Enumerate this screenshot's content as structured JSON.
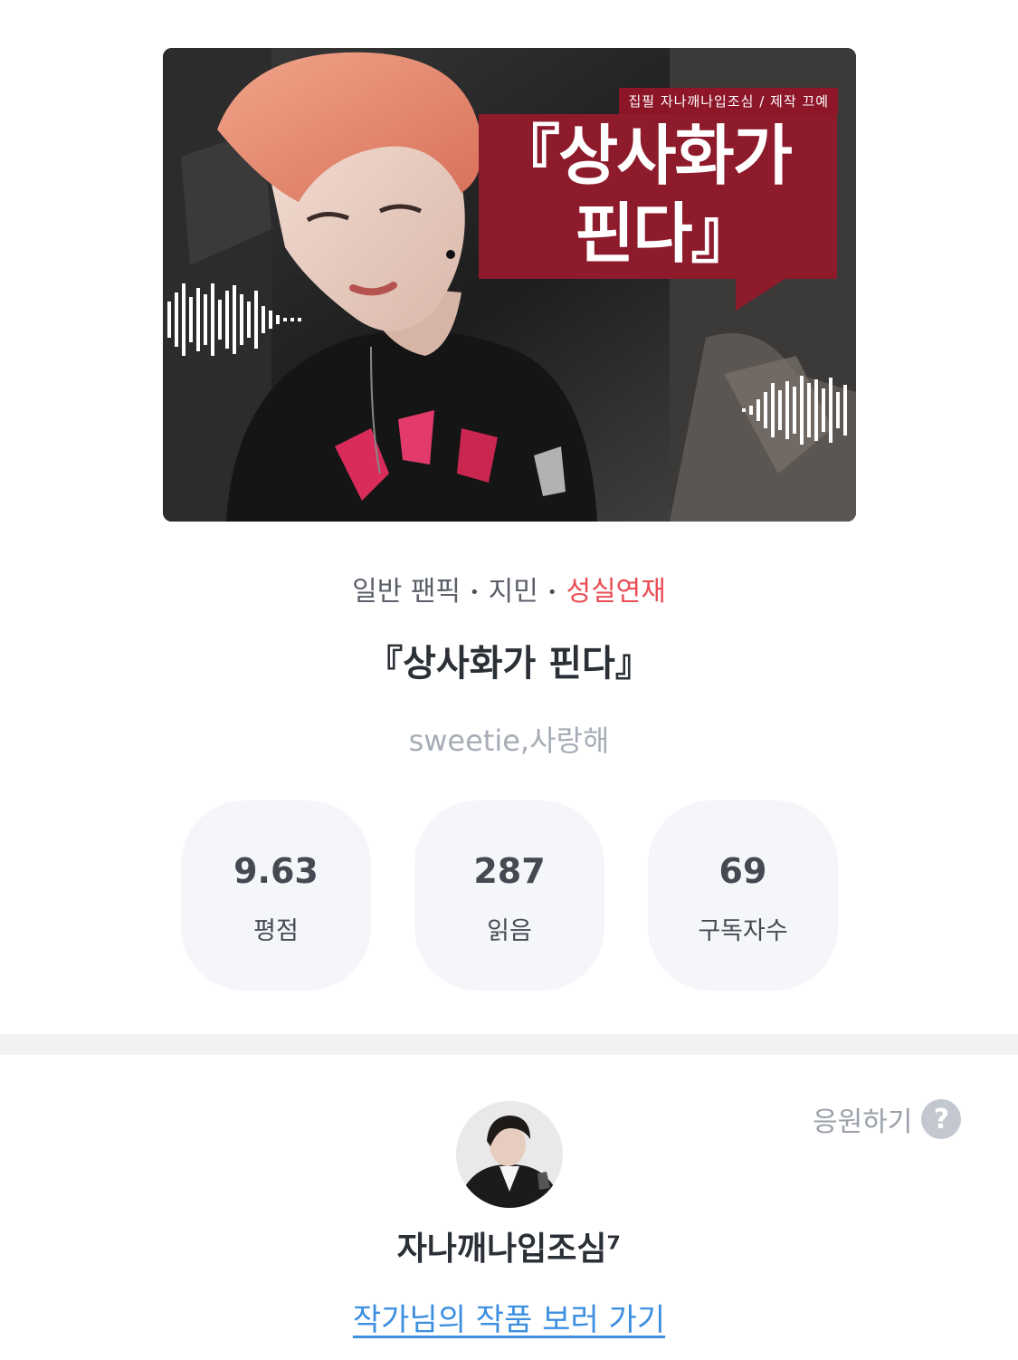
{
  "cover": {
    "credit": "집필 자나깨나입조심 / 제작 끄예",
    "title_line1": "『상사화가",
    "title_line2": "핀다』"
  },
  "meta": {
    "genre": "일반 팬픽",
    "character": "지민",
    "status": "성실연재",
    "separator": "•"
  },
  "work": {
    "title": "『상사화가 핀다』",
    "tags": "sweetie,사랑해"
  },
  "stats": [
    {
      "value": "9.63",
      "label": "평점"
    },
    {
      "value": "287",
      "label": "읽음"
    },
    {
      "value": "69",
      "label": "구독자수"
    }
  ],
  "author": {
    "cheer_label": "응원하기",
    "help_symbol": "?",
    "name": "자나깨나입조심⁷",
    "works_link": "작가님의 작품 보러 가기"
  },
  "colors": {
    "status_red": "#ea4d55",
    "link_blue": "#3d8fe0",
    "cover_banner": "#8e1b2c",
    "stat_bg": "#f4f6fa"
  }
}
